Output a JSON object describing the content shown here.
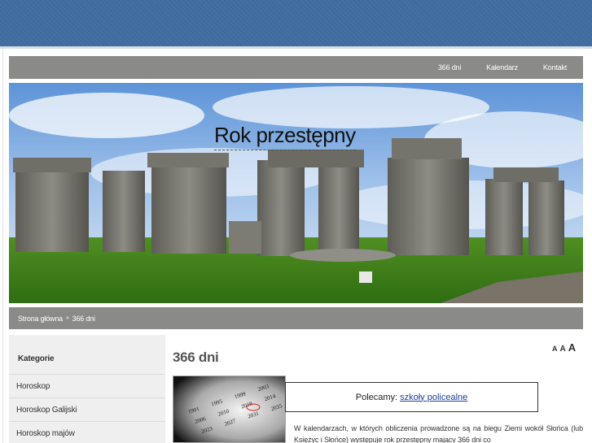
{
  "nav": {
    "items": [
      "366 dni",
      "Kalendarz",
      "Kontakt"
    ]
  },
  "header": {
    "site_title": "Rok przestępny"
  },
  "breadcrumb": {
    "home": "Strona główna",
    "separator": "»",
    "current": "366 dni"
  },
  "sidebar": {
    "heading": "Kategorie",
    "items": [
      "Horoskop",
      "Horoskop Galijski",
      "Horoskop majów"
    ]
  },
  "article": {
    "title": "366 dni",
    "font_sizes": [
      "A",
      "A",
      "A"
    ],
    "recommend_label": "Polecamy:",
    "recommend_link": "szkoły policealne",
    "text": "W kalendarzach, w których obliczenia prowadzone są na biegu Ziemi wokół Słońca (lub Księżyc i Słońce) występuje rok przestępny mający 366 dni co"
  },
  "calendar_image_years": [
    "1991",
    "1995",
    "1999",
    "2003",
    "2006",
    "2010",
    "2018",
    "2014",
    "2023",
    "2027",
    "2031",
    "2035"
  ],
  "colors": {
    "topbar": "#4470a3",
    "nav_bg": "#8a8a89",
    "link": "#1e3f9e"
  }
}
